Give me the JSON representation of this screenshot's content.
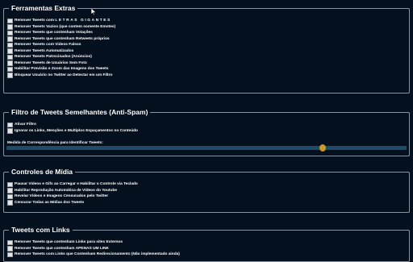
{
  "sections": {
    "extras": {
      "title": "Ferramentas Extras",
      "items": [
        {
          "label": "Remover Tweets com",
          "suffix": "LETRAS GIGANTES"
        },
        {
          "label": "Remover Tweets Vazios (que contem somente Emotes)"
        },
        {
          "label": "Remover Tweets que contenham Votações"
        },
        {
          "label": "Remover Tweets que contenham Retweets próprios"
        },
        {
          "label": "Remover Tweets com Videos Falsos"
        },
        {
          "label": "Remover Tweets Automatizados"
        },
        {
          "label": "Remover Tweets Patrocinados (Anúncios)"
        },
        {
          "label": "Remover Tweets de Usuários Sem Foto"
        },
        {
          "label": "Habilitar Previsão e Zoom das Imagens dos Tweets"
        },
        {
          "label": "Bloquear Usuário no Twitter ao Detectar em um Filtro"
        }
      ]
    },
    "antispam": {
      "title": "Filtro de Tweets Semelhantes (Anti-Spam)",
      "items": [
        {
          "label": "Ativar Filtro"
        },
        {
          "label": "Ignorar os Links, Menções e Multiplos Espaçamentos no Conteúdo"
        }
      ],
      "slider_label": "Medida de Correspondência para Identificar Tweets:",
      "slider_value": 0.79
    },
    "media": {
      "title": "Controles de Mídia",
      "items": [
        {
          "label": "Pausar Videos e Gifs ao Carregar e Habilitar o Controle via Teclado"
        },
        {
          "label": "Habilitar Reprodução Automática de Vídeos do Youtube"
        },
        {
          "label": "Revelar Vídeos e Imagens Censurados pelo Twitter"
        },
        {
          "label": "Censurar Todas as Mídias dos Tweets"
        }
      ]
    },
    "links": {
      "title": "Tweets com Links",
      "items": [
        {
          "label": "Remover Tweets que contenham Links para sites Externos"
        },
        {
          "label": "Remover Tweets que contenham APENAS UM LINK"
        },
        {
          "label": "Remover Tweets com Links que Contenham Redirecionamento (Não implementado ainda)"
        }
      ]
    }
  }
}
